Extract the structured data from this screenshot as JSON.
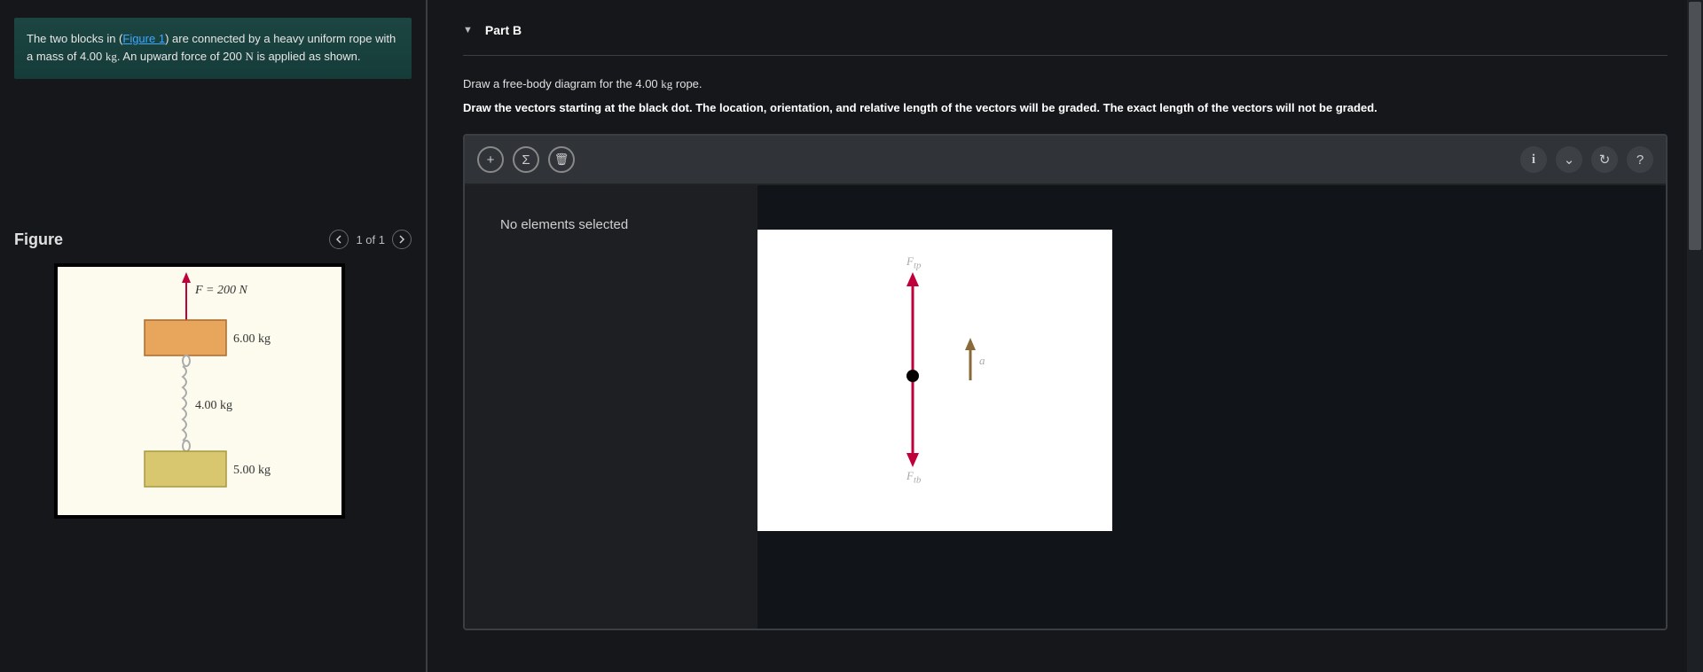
{
  "problem": {
    "text_before": "The two blocks in (",
    "figure_link": "Figure 1",
    "text_after": ") are connected by a heavy uniform rope with a mass of 4.00 ",
    "unit1": "kg",
    "text_after2": ". An upward force of 200 ",
    "unit2": "N",
    "text_after3": " is applied as shown."
  },
  "figure": {
    "title": "Figure",
    "pager": "1 of 1",
    "force_label": "F = 200 N",
    "top_mass": "6.00 kg",
    "rope_mass": "4.00 kg",
    "bottom_mass": "5.00 kg"
  },
  "part": {
    "label": "Part B",
    "instruction1_a": "Draw a free-body diagram for the 4.00 ",
    "instruction1_unit": "kg",
    "instruction1_b": " rope.",
    "instruction2": "Draw the vectors starting at the black dot. The location, orientation, and relative length of the vectors will be graded. The exact length of the vectors will not be graded."
  },
  "workspace": {
    "no_selection": "No elements selected",
    "vector_top_label": "F_tp",
    "vector_bottom_label": "F_tb",
    "accel_label": "a"
  },
  "icons": {
    "add": "+",
    "sigma": "Σ",
    "trash": "🗑",
    "info": "i",
    "expand": "⌄",
    "refresh": "↻",
    "help": "?"
  }
}
